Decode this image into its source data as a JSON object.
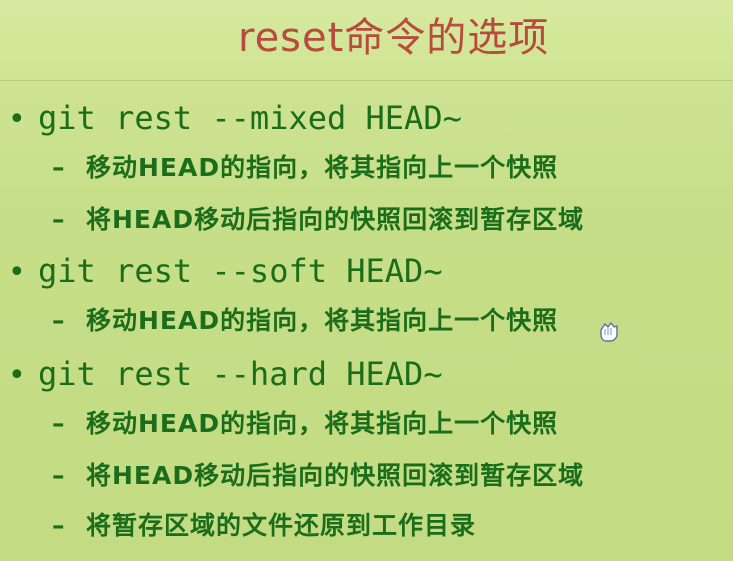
{
  "title": "reset命令的选项",
  "bullet_symbol": "•",
  "dash_symbol": "–",
  "sections": [
    {
      "command": "git rest --mixed HEAD~",
      "items": [
        "移动HEAD的指向，将其指向上一个快照",
        "将HEAD移动后指向的快照回滚到暂存区域"
      ]
    },
    {
      "command": "git rest --soft HEAD~",
      "items": [
        "移动HEAD的指向，将其指向上一个快照"
      ]
    },
    {
      "command": "git rest --hard HEAD~",
      "items": [
        "移动HEAD的指向，将其指向上一个快照",
        "将HEAD移动后指向的快照回滚到暂存区域",
        "将暂存区域的文件还原到工作目录"
      ]
    }
  ],
  "colors": {
    "background": "#c6de87",
    "title": "#b84a3f",
    "text": "#1b6d1b"
  },
  "icons": {
    "cursor": "hand-pointer-icon"
  }
}
